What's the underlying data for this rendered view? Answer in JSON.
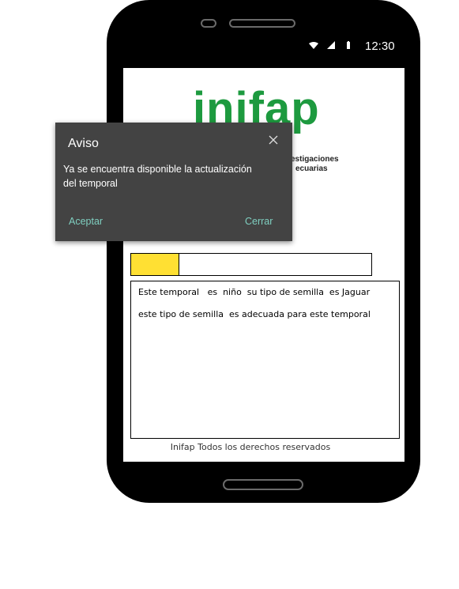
{
  "status_bar": {
    "time": "12:30",
    "icons": [
      "wifi-icon",
      "signal-icon",
      "battery-icon"
    ]
  },
  "logo": {
    "word": "inifap",
    "subtitle_line1": "estigaciones",
    "subtitle_line2": "ecuarias"
  },
  "progress": {
    "fill_fraction": 0.2,
    "fill_color": "#ffe033"
  },
  "message": {
    "line1": "Este temporal   es  niño  su tipo de semilla  es Jaguar",
    "line2": "este tipo de semilla  es adecuada para este temporal"
  },
  "footer": {
    "text": "Inifap Todos los derechos reservados"
  },
  "dialog": {
    "title": "Aviso",
    "body": "Ya se encuentra disponible la actualización del temporal",
    "accept_label": "Aceptar",
    "close_label": "Cerrar",
    "accent_color": "#7fcfc0"
  },
  "colors": {
    "brand_green": "#1d9a3f",
    "dialog_bg": "#434343"
  }
}
